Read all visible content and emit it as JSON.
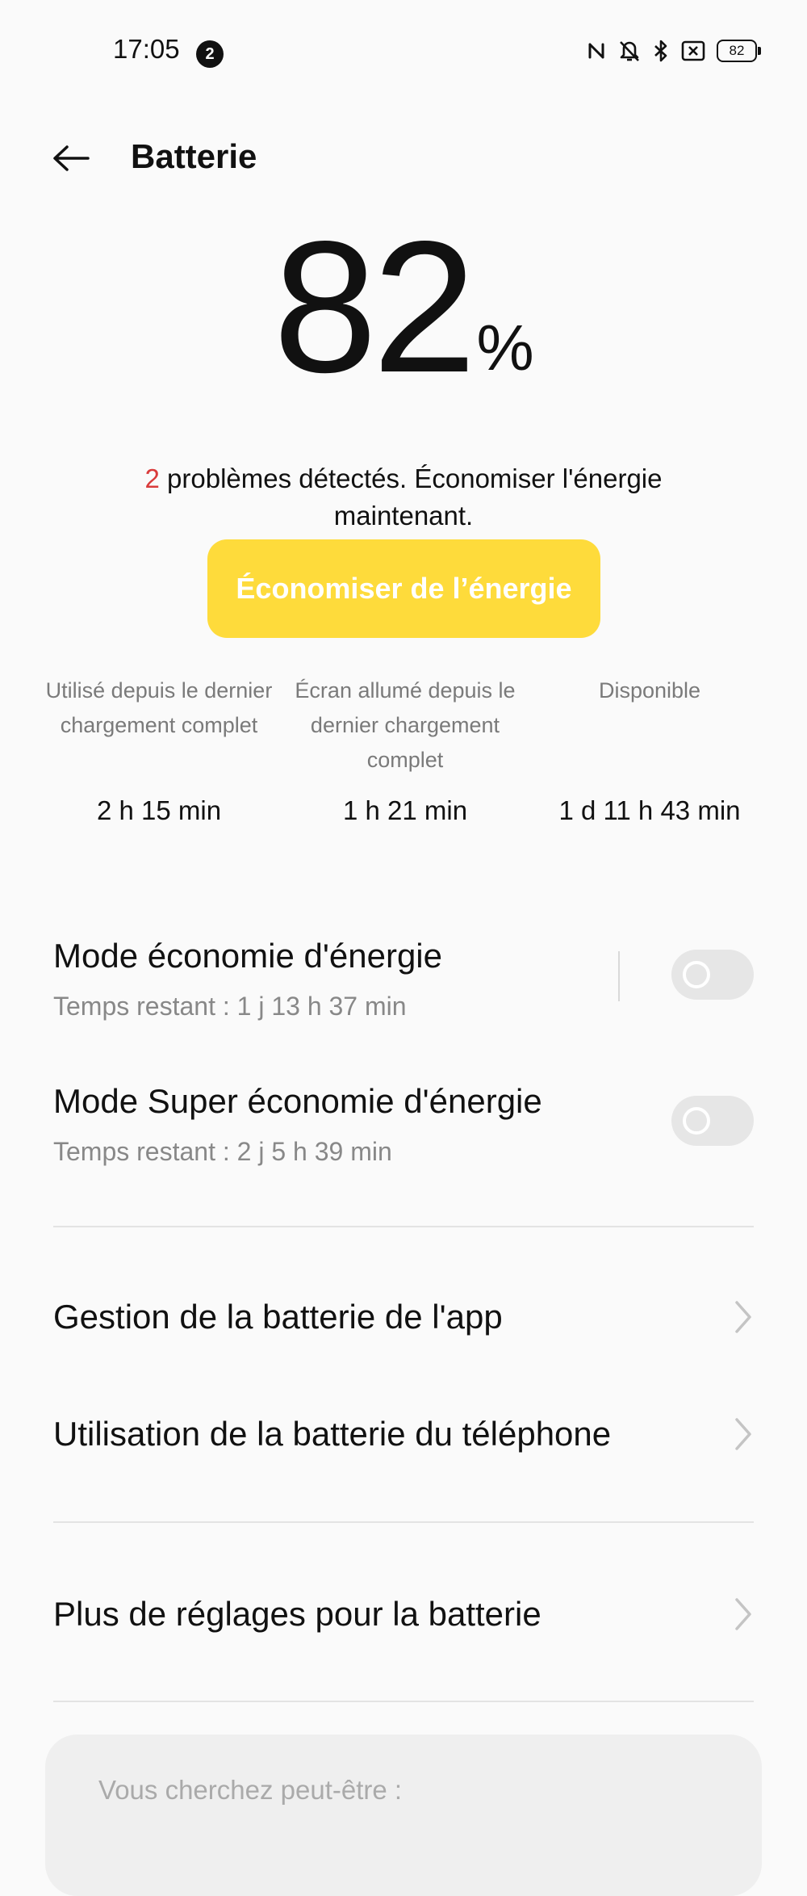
{
  "status_bar": {
    "time": "17:05",
    "notification_count": "2",
    "battery_level": "82",
    "icons": [
      "nfc-icon",
      "silent-icon",
      "bluetooth-icon",
      "no-sim-icon",
      "battery-icon"
    ]
  },
  "header": {
    "back_icon": "arrow-left-icon",
    "title": "Batterie"
  },
  "battery": {
    "percent": "82",
    "percent_symbol": "%"
  },
  "problems": {
    "count": "2",
    "text": " problèmes détectés. Économiser l'énergie maintenant."
  },
  "save_button": {
    "label": "Économiser de l’énergie",
    "color": "#fedb3b"
  },
  "stats": [
    {
      "label": "Utilisé depuis le dernier chargement complet",
      "value": "2 h 15 min"
    },
    {
      "label": "Écran allumé depuis le dernier chargement complet",
      "value": "1 h 21 min"
    },
    {
      "label": "Disponible",
      "value": "1 d 11 h 43 min"
    }
  ],
  "modes": [
    {
      "title": "Mode économie d'énergie",
      "subtitle": "Temps restant :  1 j 13 h 37 min",
      "enabled": false
    },
    {
      "title": "Mode Super économie d'énergie",
      "subtitle": "Temps restant :  2 j 5 h 39 min",
      "enabled": false
    }
  ],
  "nav_items": [
    {
      "label": "Gestion de la batterie de l'app"
    },
    {
      "label": "Utilisation de la batterie du téléphone"
    },
    {
      "label": "Plus de réglages pour la batterie"
    }
  ],
  "suggestions": {
    "title": "Vous cherchez peut-être :"
  }
}
